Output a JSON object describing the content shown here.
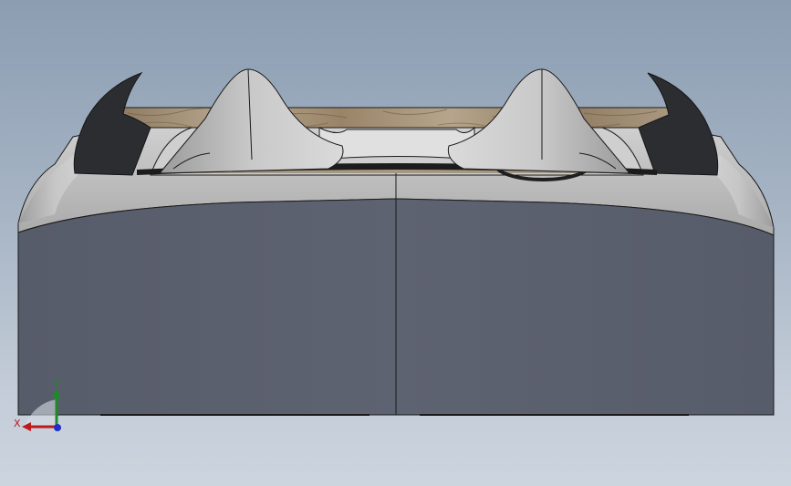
{
  "viewport": {
    "background_top": "#8c9db2",
    "background_bottom": "#ccd4de",
    "model": "car-rear-view"
  },
  "colors": {
    "body_lower": "#5a606e",
    "body_upper": "#b9b9b9",
    "edge_line": "#1b1b1b",
    "fin_dark": "#2a2c30",
    "wood": "#9c8a70"
  },
  "triad": {
    "x_label": "X",
    "y_label": "Y",
    "x_color": "#c0191b",
    "y_color": "#1e8a2a",
    "z_color": "#1f2ec8"
  }
}
